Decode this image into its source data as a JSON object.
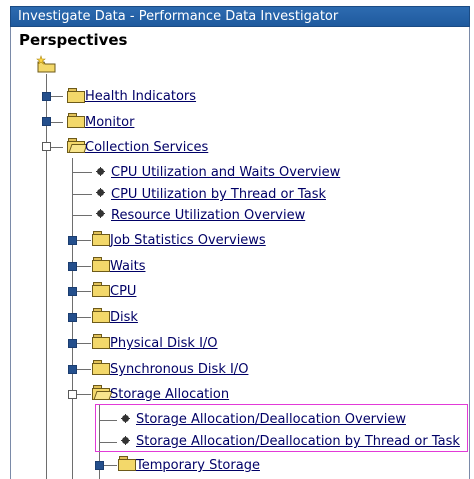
{
  "window": {
    "title": "Investigate Data - Performance Data Investigator"
  },
  "tree": {
    "heading": "Perspectives",
    "items": {
      "health_indicators": "Health Indicators",
      "monitor": "Monitor",
      "collection_services": "Collection Services",
      "cpu_util_waits": "CPU Utilization and Waits Overview",
      "cpu_util_thread": "CPU Utilization by Thread or Task",
      "resource_util": "Resource Utilization Overview",
      "job_statistics": "Job Statistics Overviews",
      "waits": "Waits",
      "cpu": "CPU",
      "disk": "Disk",
      "physical_disk_io": "Physical Disk I/O",
      "synchronous_disk_io": "Synchronous Disk I/O",
      "storage_allocation": "Storage Allocation",
      "storage_alloc_overview": "Storage Allocation/Deallocation Overview",
      "storage_alloc_thread": "Storage Allocation/Deallocation by Thread or Task",
      "temporary_storage": "Temporary Storage"
    }
  },
  "colors": {
    "title_bar": "#1f5a9e",
    "link": "#000066",
    "highlight_border": "#e23ad8",
    "expander_closed": "#244f8c",
    "folder": "#f3d86a"
  }
}
